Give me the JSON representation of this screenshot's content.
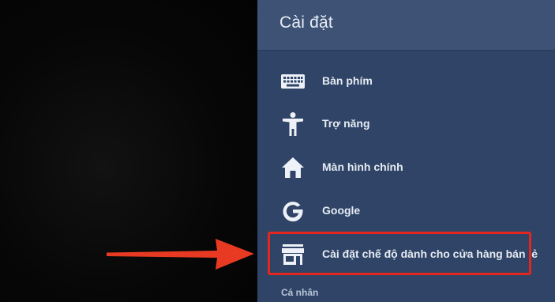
{
  "settings": {
    "title": "Cài đặt",
    "items": [
      {
        "label": "Bàn phím",
        "icon": "keyboard-icon"
      },
      {
        "label": "Trợ năng",
        "icon": "accessibility-icon"
      },
      {
        "label": "Màn hình chính",
        "icon": "home-icon"
      },
      {
        "label": "Google",
        "icon": "google-icon"
      },
      {
        "label": "Cài đặt chế độ dành cho cửa hàng bán lẻ",
        "icon": "store-icon"
      }
    ],
    "section_header": "Cá nhân"
  },
  "colors": {
    "panel": "#2f4466",
    "header": "#3d5275",
    "highlight": "#e4261e",
    "arrow": "#e83a22"
  }
}
